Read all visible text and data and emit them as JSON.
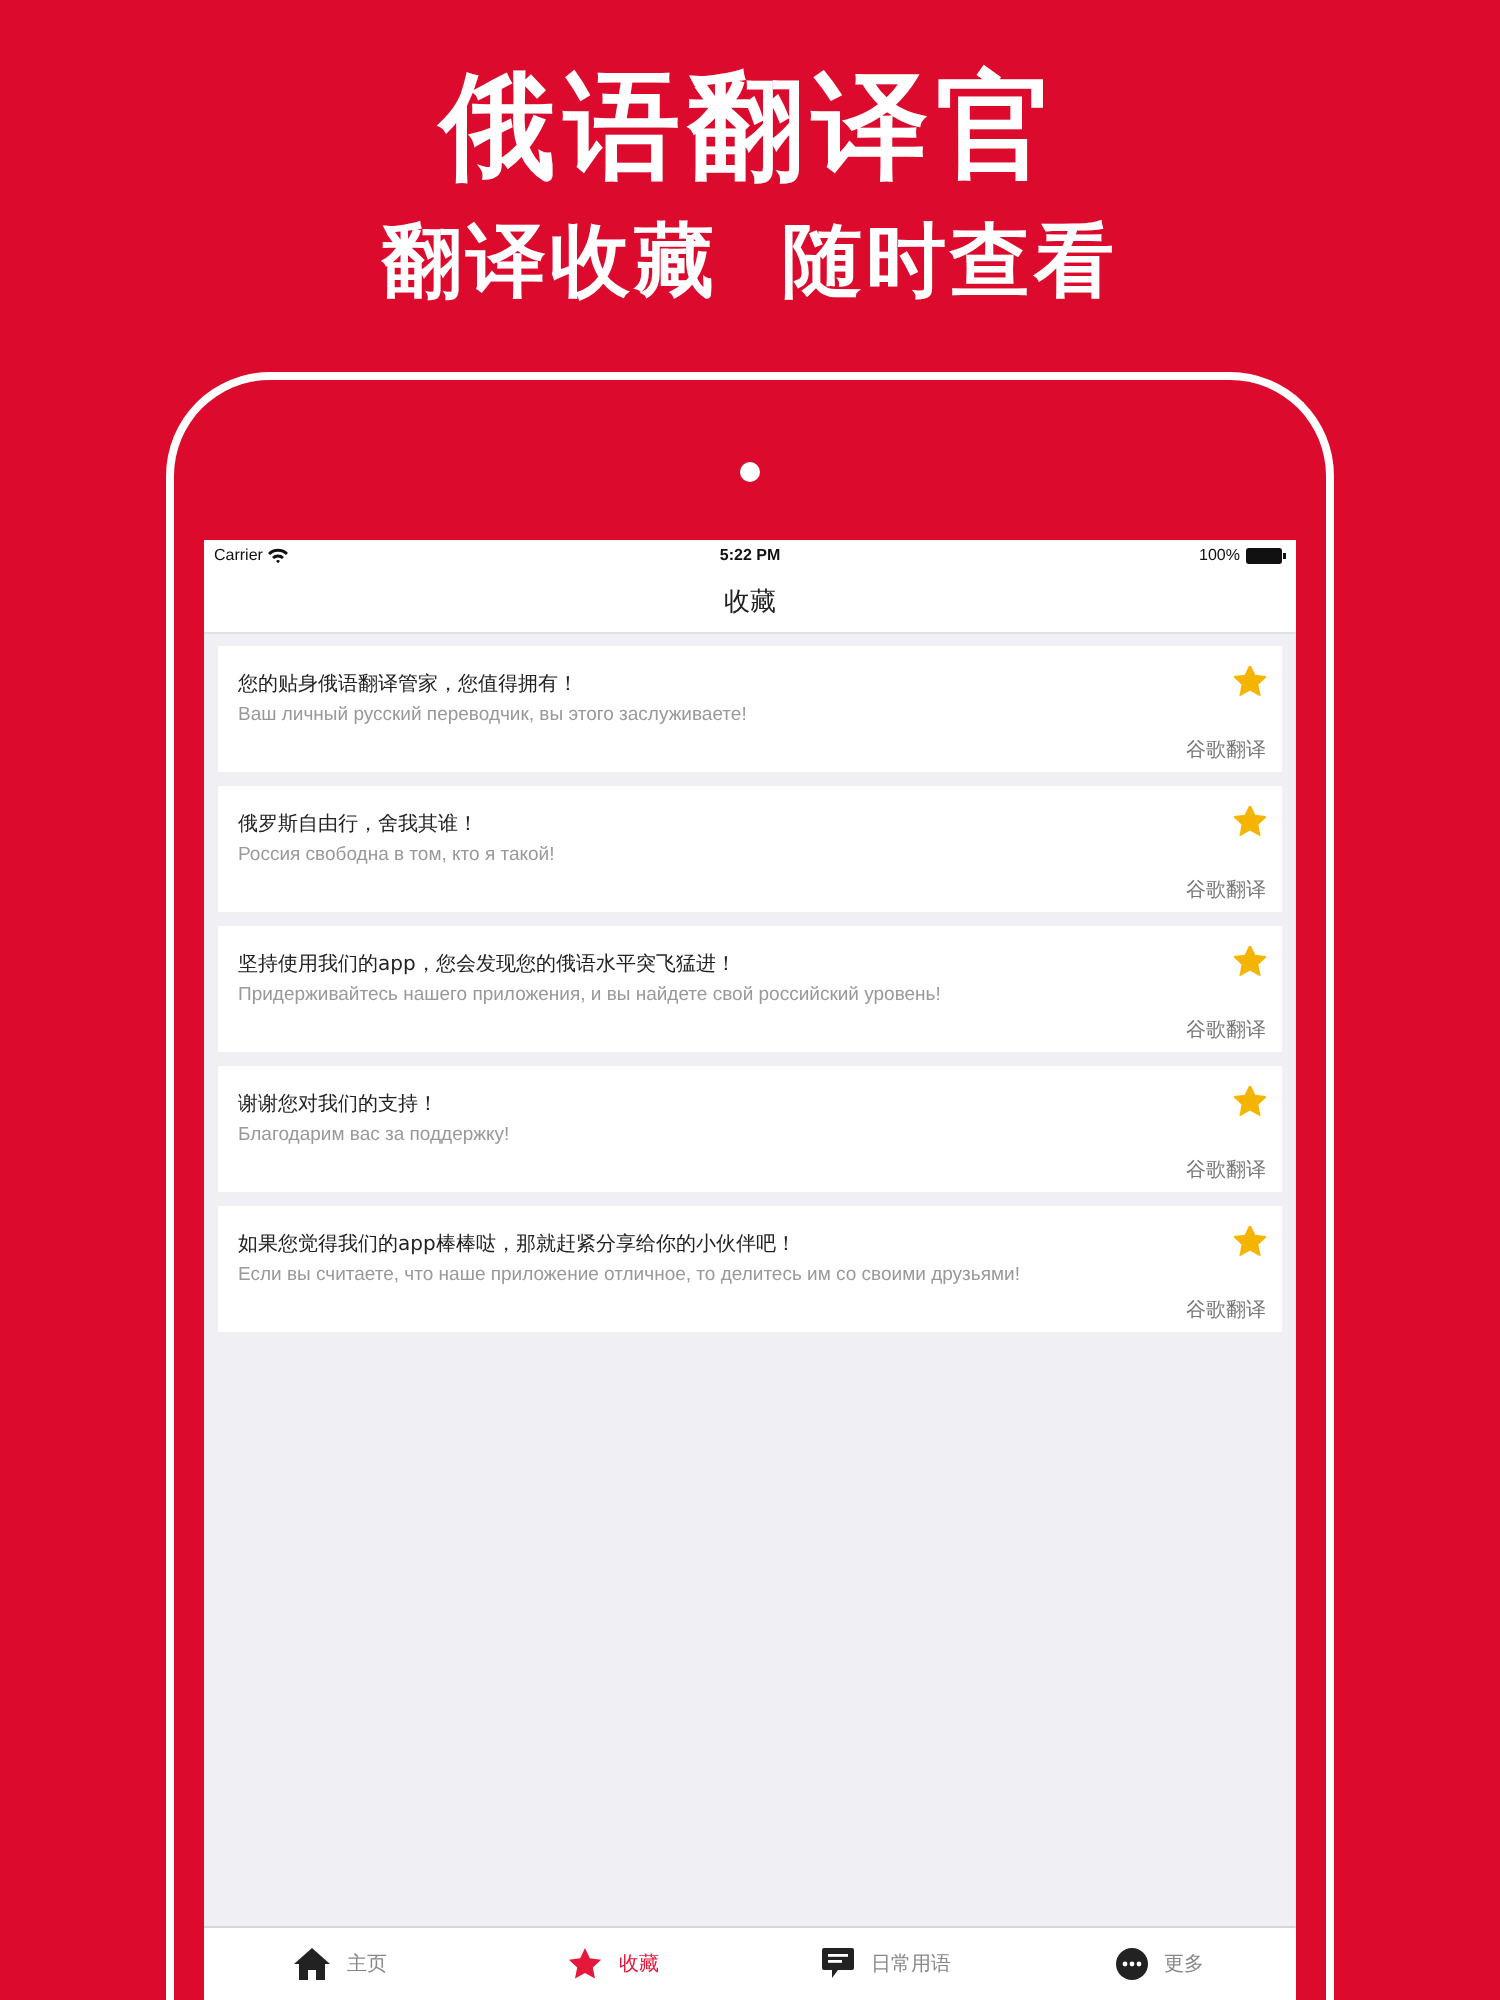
{
  "headline": "俄语翻译官",
  "subheadline": "翻译收藏  随时查看",
  "status_bar": {
    "carrier": "Carrier",
    "time": "5:22 PM",
    "battery": "100%"
  },
  "nav_title": "收藏",
  "favorites": [
    {
      "chinese": "您的贴身俄语翻译管家，您值得拥有！",
      "russian": "Ваш личный русский переводчик, вы этого заслуживаете!",
      "source": "谷歌翻译",
      "starred": true
    },
    {
      "chinese": "俄罗斯自由行，舍我其谁！",
      "russian": "Россия свободна в том, кто я такой!",
      "source": "谷歌翻译",
      "starred": true
    },
    {
      "chinese": "坚持使用我们的app，您会发现您的俄语水平突飞猛进！",
      "russian": "Придерживайтесь нашего приложения, и вы найдете свой российский уровень!",
      "source": "谷歌翻译",
      "starred": true
    },
    {
      "chinese": "谢谢您对我们的支持！",
      "russian": "Благодарим вас за поддержку!",
      "source": "谷歌翻译",
      "starred": true
    },
    {
      "chinese": "如果您觉得我们的app棒棒哒，那就赶紧分享给你的小伙伴吧！",
      "russian": "Если вы считаете, что наше приложение отличное, то делитесь им со своими друзьями!",
      "source": "谷歌翻译",
      "starred": true
    }
  ],
  "tabs": [
    {
      "label": "主页",
      "kind": "home",
      "selected": false
    },
    {
      "label": "收藏",
      "kind": "star",
      "selected": true
    },
    {
      "label": "日常用语",
      "kind": "chat",
      "selected": false
    },
    {
      "label": "更多",
      "kind": "more",
      "selected": false
    }
  ]
}
